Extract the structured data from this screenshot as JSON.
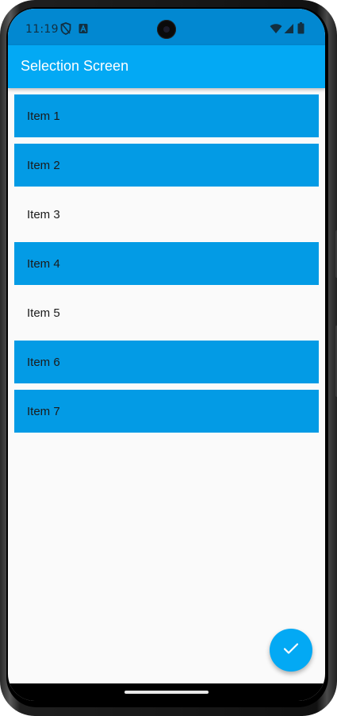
{
  "status_bar": {
    "time": "11:19",
    "left_icons": [
      "shield-icon",
      "text-a-icon"
    ],
    "right_icons": [
      "wifi-icon",
      "signal-icon",
      "battery-icon"
    ]
  },
  "app_bar": {
    "title": "Selection Screen",
    "color": "#03a9f4"
  },
  "list": {
    "items": [
      {
        "label": "Item 1",
        "selected": true
      },
      {
        "label": "Item 2",
        "selected": true
      },
      {
        "label": "Item 3",
        "selected": false
      },
      {
        "label": "Item 4",
        "selected": true
      },
      {
        "label": "Item 5",
        "selected": false
      },
      {
        "label": "Item 6",
        "selected": true
      },
      {
        "label": "Item 7",
        "selected": true
      }
    ],
    "selected_color": "#039be5"
  },
  "fab": {
    "icon": "check-icon",
    "color": "#03a9f4"
  }
}
